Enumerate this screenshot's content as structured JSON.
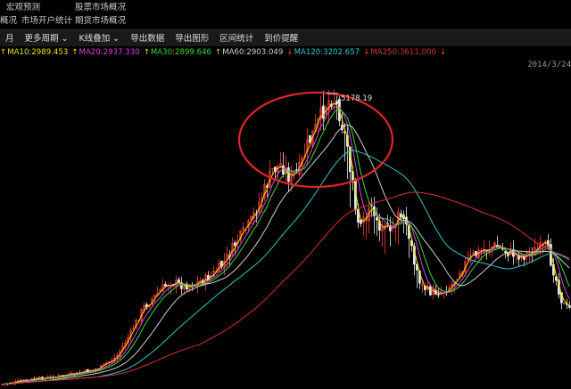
{
  "menu": {
    "row1": [
      {
        "id": "macro",
        "label": "宏观预测"
      },
      {
        "id": "stock-market",
        "label": "股票市场概况"
      }
    ],
    "row2": [
      {
        "id": "overview-cut",
        "label": "概况"
      },
      {
        "id": "account-stats",
        "label": "市场开户统计"
      },
      {
        "id": "futures-market",
        "label": "期货市场概况"
      }
    ]
  },
  "toolbar": [
    {
      "id": "month",
      "label": "月"
    },
    {
      "id": "more-period",
      "label": "更多周期 ⌄"
    },
    {
      "id": "k-overlay",
      "label": "K线叠加 ⌄"
    },
    {
      "id": "export-data",
      "label": "导出数据"
    },
    {
      "id": "export-chart",
      "label": "导出图形"
    },
    {
      "id": "range-stats",
      "label": "区间统计"
    },
    {
      "id": "alert",
      "label": "到价提醒"
    }
  ],
  "ma_lines": [
    {
      "name": "MA10",
      "text": "MA10:2989.453",
      "arrow": "↑",
      "color": "#e6e600"
    },
    {
      "name": "MA20",
      "text": "MA20:2937.330",
      "arrow": "↑",
      "color": "#e040e0"
    },
    {
      "name": "MA30",
      "text": "MA30:2899.646",
      "arrow": "↑",
      "color": "#33dd33"
    },
    {
      "name": "MA60",
      "text": "MA60:2903.049",
      "arrow": "↑",
      "color": "#cfcfcf"
    },
    {
      "name": "MA120",
      "text": "MA120:3202.657",
      "arrow": "↓",
      "color": "#33c9cc"
    },
    {
      "name": "MA250",
      "text": "MA250:3611.000",
      "arrow": "↓",
      "color": "#e03030"
    }
  ],
  "date_label": "2014/3/24",
  "peak_label": "5178.19",
  "colors": {
    "up": "#ff3b3b",
    "down": "#e6e6e6",
    "highlight_circle": "#e02525"
  }
}
